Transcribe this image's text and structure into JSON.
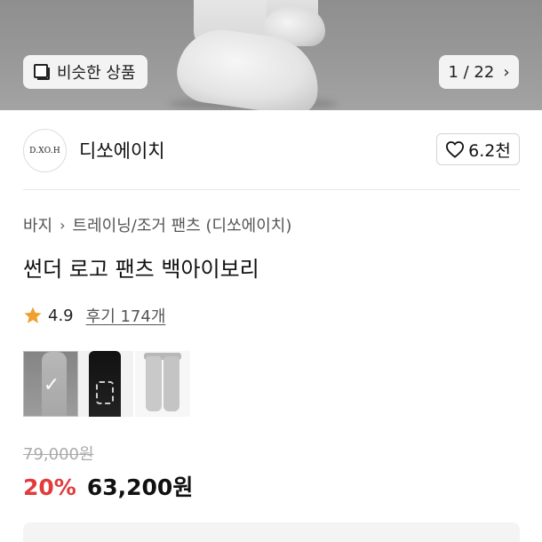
{
  "hero": {
    "similar_label": "비슷한 상품",
    "counter": "1 / 22"
  },
  "store": {
    "logo_text": "D.XO.H",
    "name": "디쏘에이치",
    "likes": "6.2천"
  },
  "breadcrumb": {
    "category": "바지",
    "subcategory": "트레이닝/조거 팬츠 (디쏘에이치)"
  },
  "product": {
    "title": "썬더 로고 팬츠 백아이보리",
    "rating": "4.9",
    "reviews": "후기 174개",
    "original_price": "79,000원",
    "discount": "20%",
    "price": "63,200원"
  },
  "colors": {
    "accent_red": "#e23b3b",
    "star": "#f0a030"
  }
}
